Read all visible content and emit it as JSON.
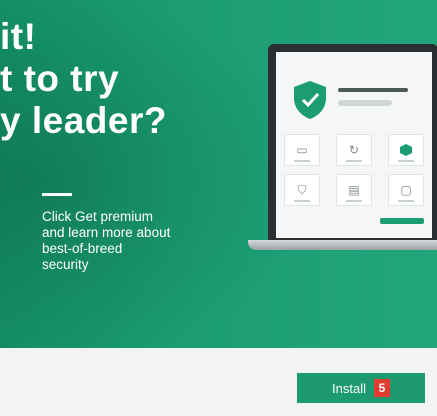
{
  "promo": {
    "headline_lines": [
      "it!",
      "t to try",
      "y leader?"
    ],
    "body_lines": [
      "Click Get premium",
      "and learn more about",
      "best-of-breed",
      "security"
    ]
  },
  "colors": {
    "brand_green": "#1b9c72",
    "countdown_red": "#e23b2f"
  },
  "illustration": {
    "icons": [
      "shield-check-icon",
      "monitor-icon",
      "refresh-icon",
      "hexagon-icon",
      "shield-small-icon",
      "card-icon",
      "device-icon"
    ]
  },
  "footer": {
    "install_label": "Install",
    "countdown_value": "5"
  }
}
